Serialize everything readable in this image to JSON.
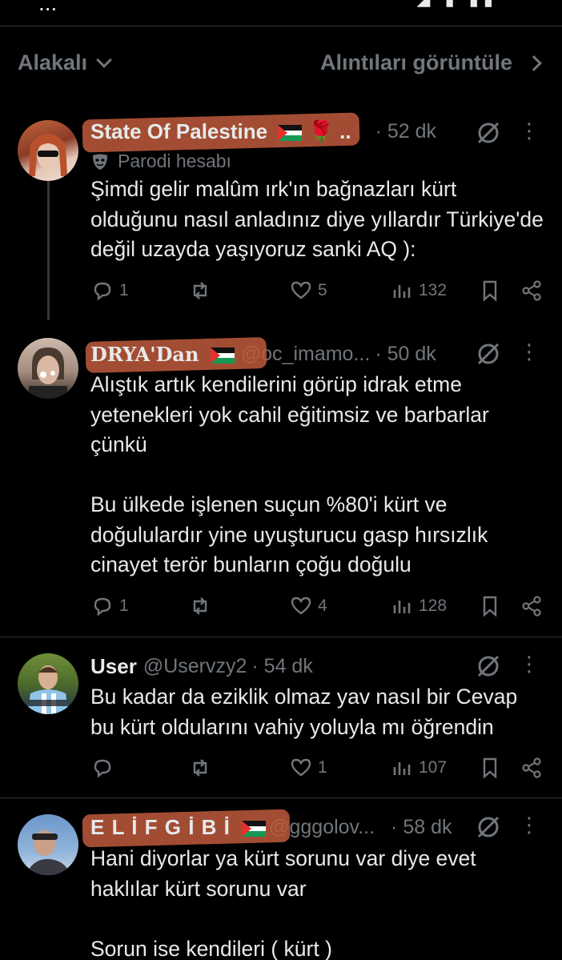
{
  "statusbar": {
    "time": "...",
    "icons": "◢ ▮ ▮▮"
  },
  "topbar": {
    "sort_label": "Alakalı",
    "quotes_label": "Alıntıları görüntüle"
  },
  "tweets": [
    {
      "name": "State Of Palestine",
      "name_suffix": "🌹 ..",
      "handle": "",
      "time": "· 52 dk",
      "parody": "Parodi hesabı",
      "text": "Şimdi gelir malûm ırk'ın bağnazları kürt olduğunu nasıl anladınız diye yıllardır Türkiye'de değil uzayda yaşıyoruz sanki AQ ):",
      "replies": "1",
      "reposts": "",
      "likes": "5",
      "views": "132"
    },
    {
      "name": "DRYA'Dan",
      "handle": "@oc_imamo...",
      "time": "· 50 dk",
      "text": "Alıştık artık kendilerini görüp idrak etme yetenekleri yok cahil eğitimsiz ve barbarlar çünkü\n\nBu ülkede işlenen suçun %80'i kürt ve doğululardır yine uyuşturucu gasp hırsızlık cinayet terör bunların çoğu doğulu",
      "replies": "1",
      "reposts": "",
      "likes": "4",
      "views": "128"
    },
    {
      "name": "User",
      "handle": "@Uservzy2",
      "time": "· 54 dk",
      "text": "Bu kadar da eziklik olmaz yav nasıl bir Cevap bu kürt oldularını vahiy yoluyla mı öğrendin",
      "replies": "",
      "reposts": "",
      "likes": "1",
      "views": "107"
    },
    {
      "name": "E L İ F G İ B İ",
      "handle": "@gggolov...",
      "time": "· 58 dk",
      "text": "Hani diyorlar ya kürt sorunu var diye evet haklılar kürt sorunu var\n\nSorun ise kendileri ( kürt )"
    }
  ],
  "colors": {
    "background": "#000000",
    "text": "#e7e9ea",
    "muted": "#71767b",
    "divider": "#2f3336",
    "scribble": "#be5a3c"
  }
}
